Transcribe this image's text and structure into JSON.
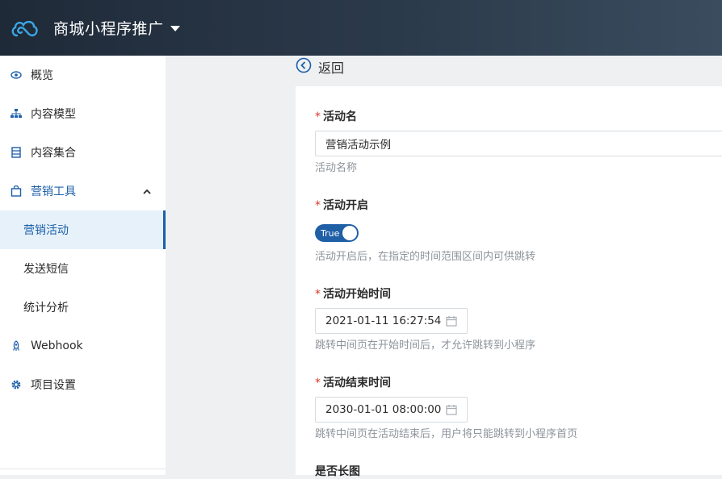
{
  "header": {
    "app_title": "商城小程序推广",
    "logo_icon": "cloud-logo-icon"
  },
  "sidebar": {
    "items": [
      {
        "label": "概览",
        "icon": "eye-icon"
      },
      {
        "label": "内容模型",
        "icon": "sitemap-icon"
      },
      {
        "label": "内容集合",
        "icon": "database-icon"
      },
      {
        "label": "营销工具",
        "icon": "shopping-bag-icon",
        "expanded": true
      },
      {
        "label": "营销活动",
        "active": true
      },
      {
        "label": "发送短信"
      },
      {
        "label": "统计分析"
      },
      {
        "label": "Webhook",
        "icon": "rocket-icon"
      },
      {
        "label": "项目设置",
        "icon": "gear-icon"
      }
    ]
  },
  "back": {
    "label": "返回"
  },
  "form": {
    "name": {
      "label": "活动名",
      "value": "营销活动示例",
      "help": "活动名称"
    },
    "enabled": {
      "label": "活动开启",
      "toggle_text": "True",
      "value": true,
      "help": "活动开启后，在指定的时间范围区间内可供跳转"
    },
    "start": {
      "label": "活动开始时间",
      "value": "2021-01-11 16:27:54",
      "help": "跳转中间页在开始时间后，才允许跳转到小程序"
    },
    "end": {
      "label": "活动结束时间",
      "value": "2030-01-01 08:00:00",
      "help": "跳转中间页在活动结束后，用户将只能跳转到小程序首页"
    },
    "long_image": {
      "label": "是否长图"
    }
  },
  "colors": {
    "accent": "#1c5fa8",
    "required": "#d9362b",
    "header_bg": "#1f2a38"
  }
}
